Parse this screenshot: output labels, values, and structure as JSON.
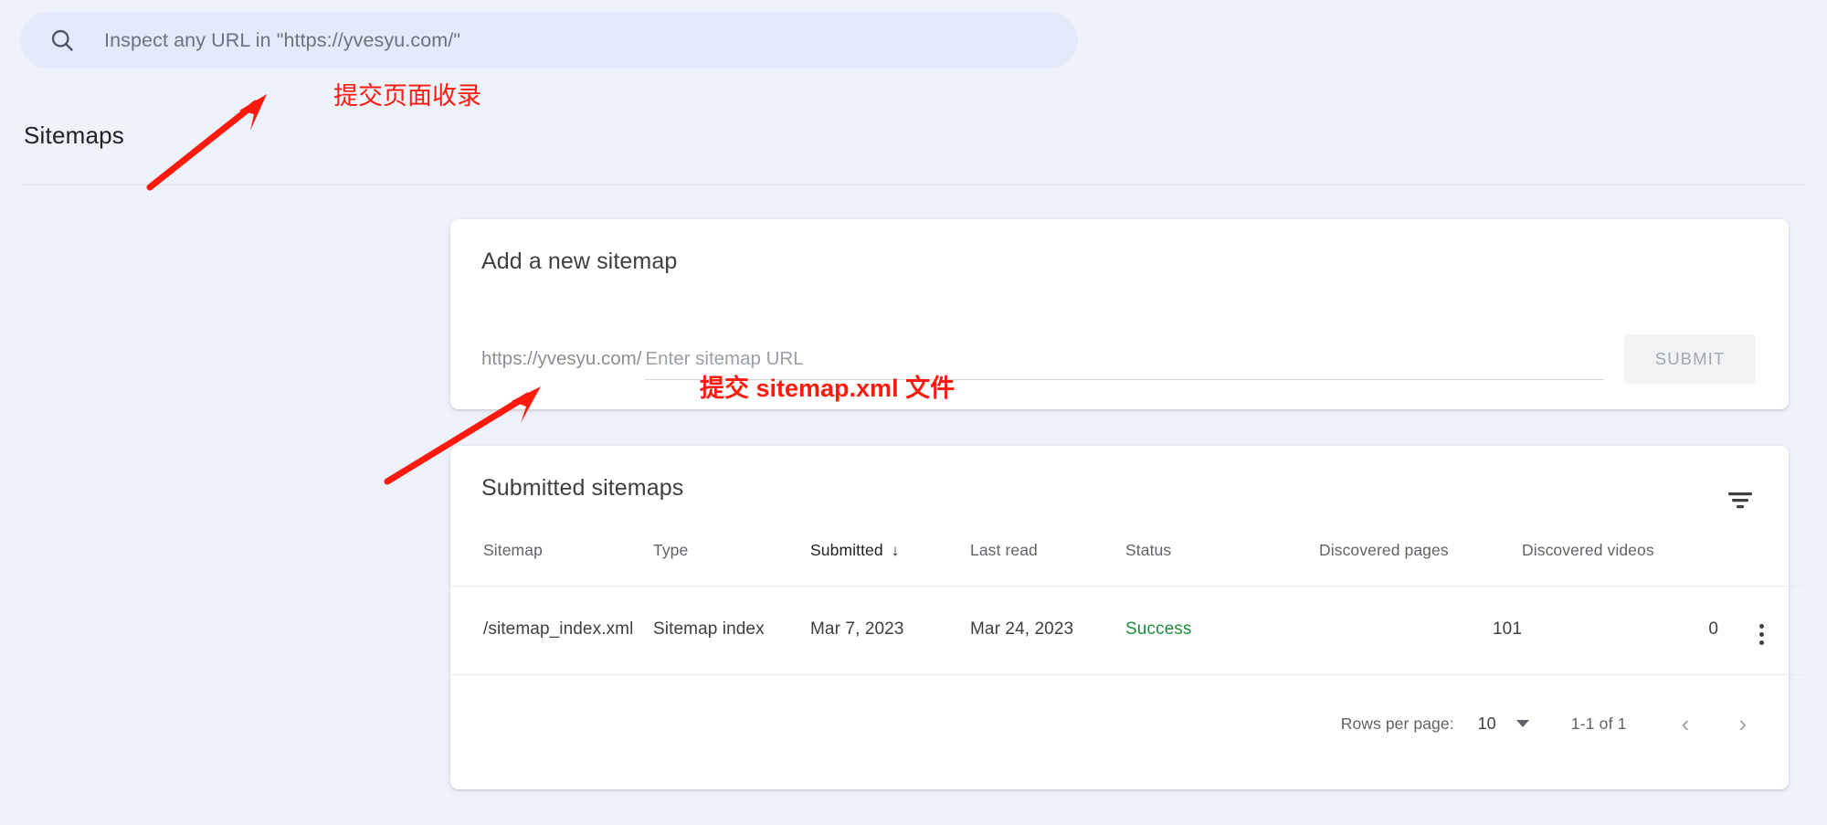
{
  "search": {
    "icon": "search-icon",
    "placeholder": "Inspect any URL in \"https://yvesyu.com/\"",
    "value": ""
  },
  "page": {
    "title": "Sitemaps"
  },
  "add_sitemap": {
    "heading": "Add a new sitemap",
    "url_prefix": "https://yvesyu.com/",
    "input_placeholder": "Enter sitemap URL",
    "input_value": "",
    "submit_label": "SUBMIT"
  },
  "submitted": {
    "heading": "Submitted sitemaps",
    "filter_icon": "filter-icon",
    "columns": [
      {
        "label": "Sitemap",
        "sorted": false
      },
      {
        "label": "Type",
        "sorted": false
      },
      {
        "label": "Submitted",
        "sorted": true,
        "sort_arrow": "↓"
      },
      {
        "label": "Last read",
        "sorted": false
      },
      {
        "label": "Status",
        "sorted": false
      },
      {
        "label": "Discovered pages",
        "sorted": false
      },
      {
        "label": "Discovered videos",
        "sorted": false
      }
    ],
    "rows": [
      {
        "sitemap": "/sitemap_index.xml",
        "type": "Sitemap index",
        "submitted": "Mar 7, 2023",
        "last_read": "Mar 24, 2023",
        "status": "Success",
        "status_color": "#1e8e3e",
        "discovered_pages": "101",
        "discovered_videos": "0",
        "menu_icon": "more-vert-icon"
      }
    ],
    "pagination": {
      "rows_per_page_label": "Rows per page:",
      "rows_per_page_value": "10",
      "range": "1-1 of 1",
      "prev_icon": "‹",
      "next_icon": "›"
    }
  },
  "annotations": [
    {
      "text": "提交页面收录",
      "color": "#ff1a0d"
    },
    {
      "text": "提交 sitemap.xml 文件",
      "color": "#ff1a0d"
    }
  ],
  "colors": {
    "page_background": "#eef2fa",
    "search_background": "#e3ebfb",
    "card_background": "#ffffff",
    "success_green": "#1e8e3e",
    "annotation_red": "#ff1a0d"
  }
}
